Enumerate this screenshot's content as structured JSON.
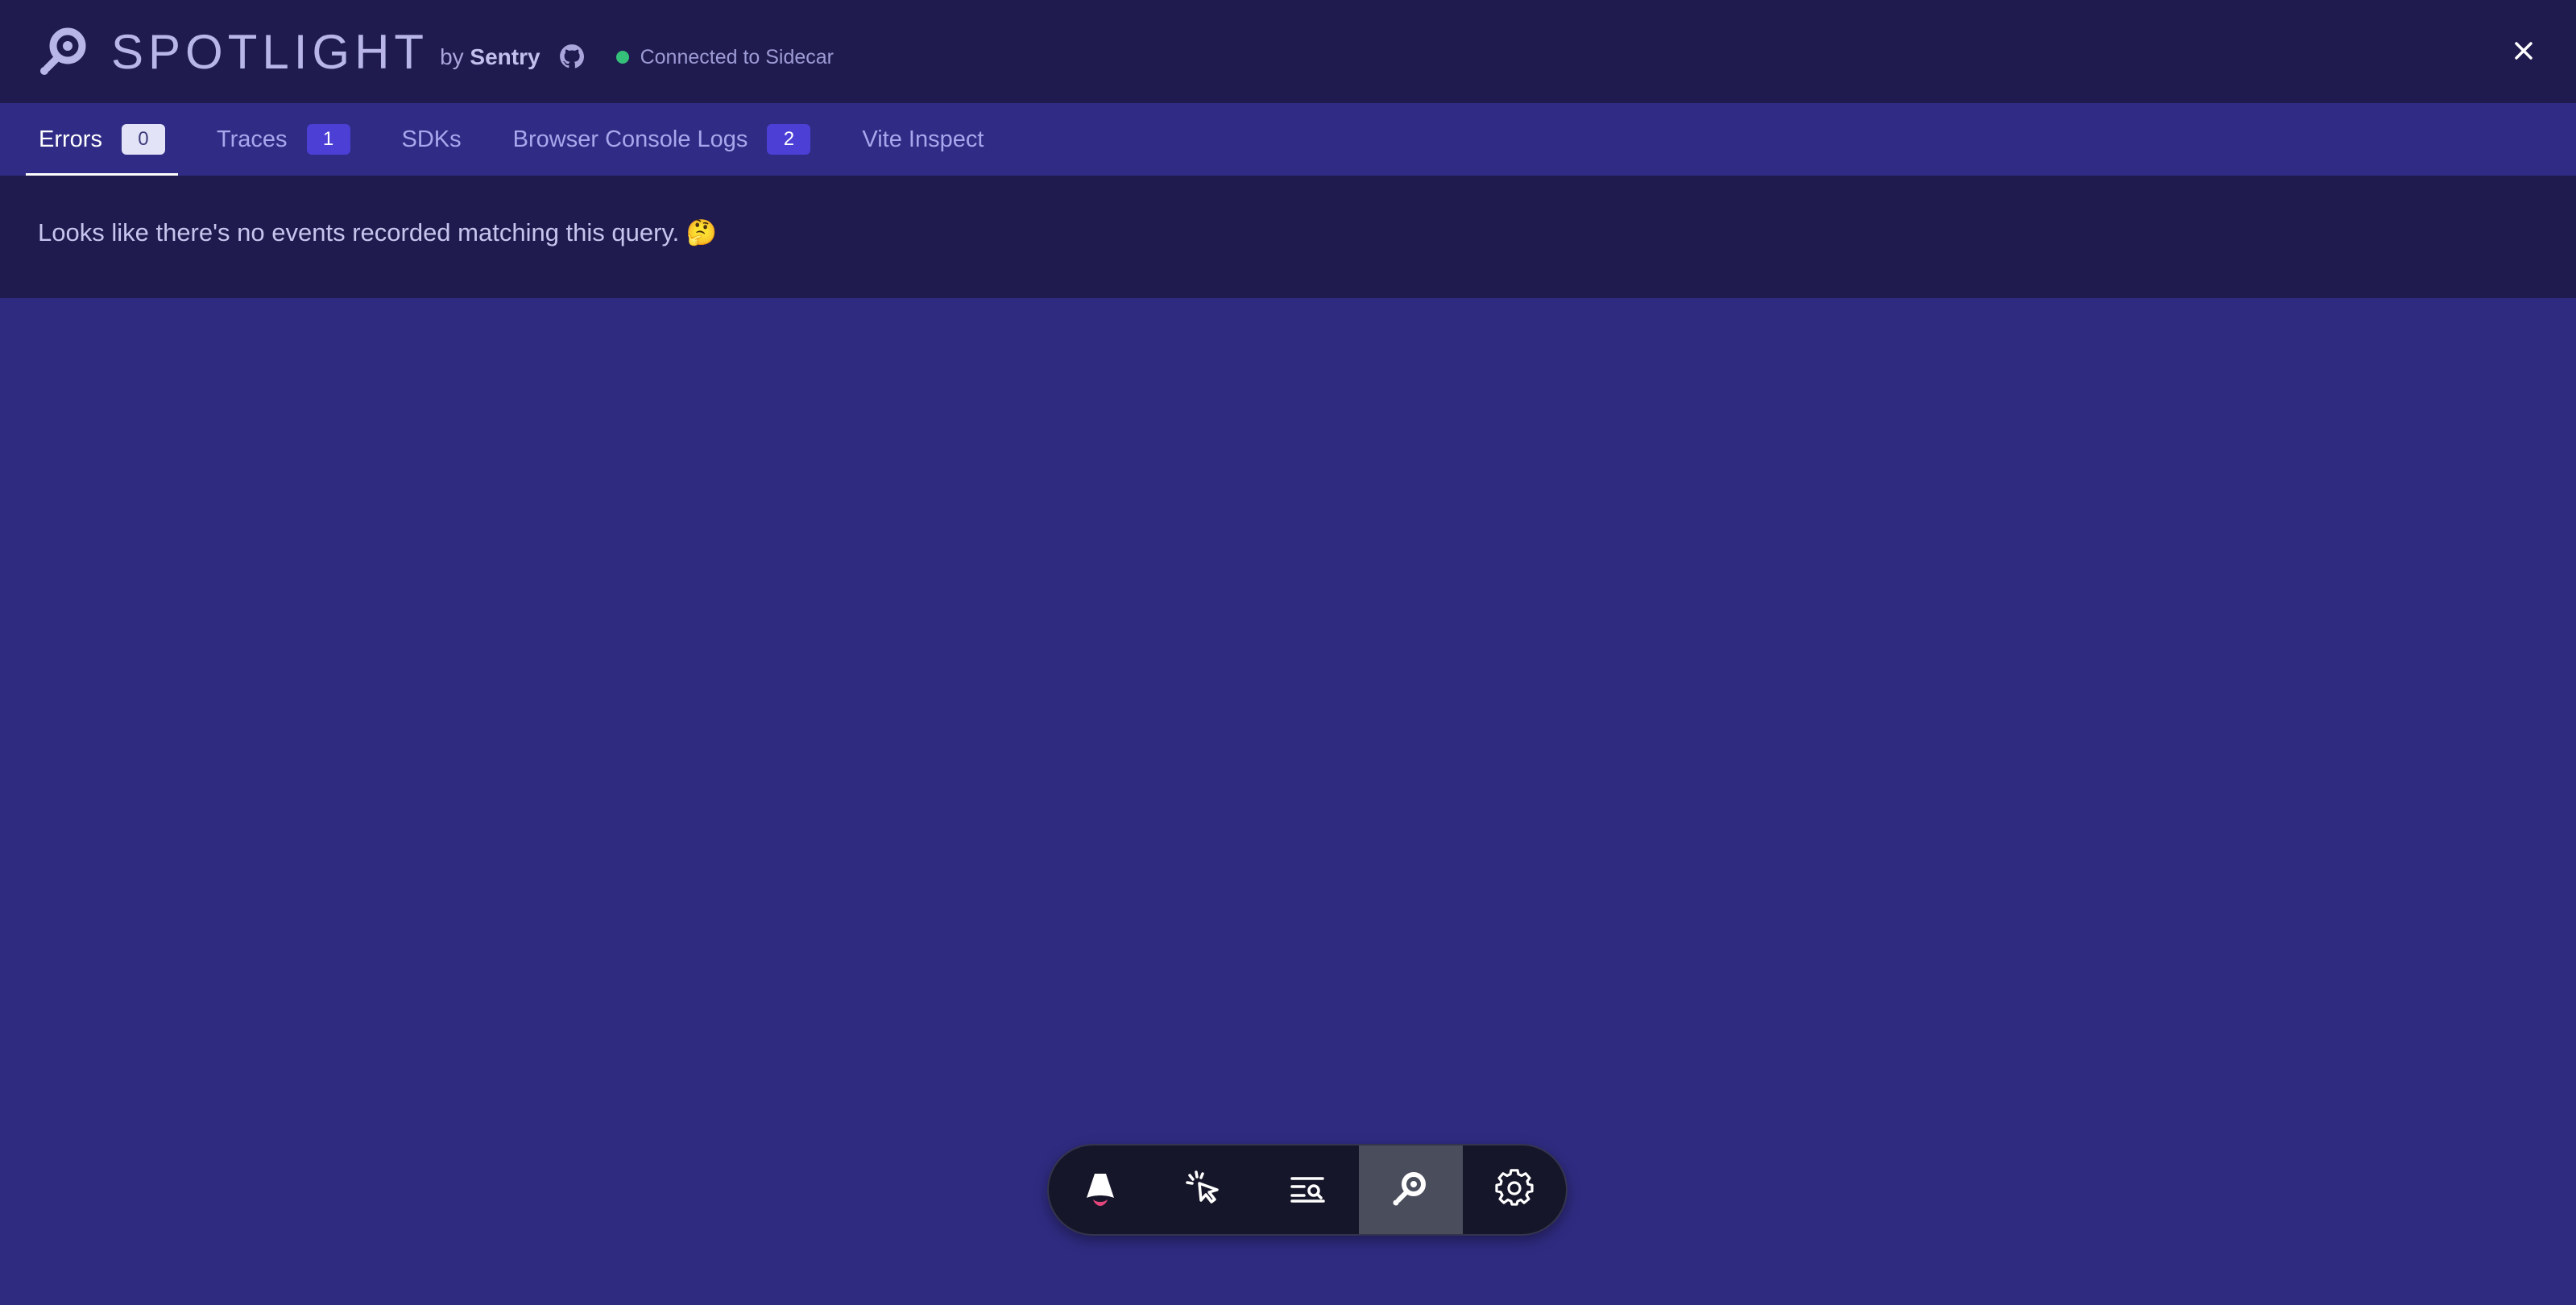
{
  "header": {
    "brand": "SPOTLIGHT",
    "by_prefix": "by",
    "by_name": "Sentry",
    "status_text": "Connected to Sidecar",
    "status_color": "#35c07a"
  },
  "tabs": [
    {
      "label": "Errors",
      "badge": "0",
      "active": true
    },
    {
      "label": "Traces",
      "badge": "1",
      "active": false
    },
    {
      "label": "SDKs",
      "badge": null,
      "active": false
    },
    {
      "label": "Browser Console Logs",
      "badge": "2",
      "active": false
    },
    {
      "label": "Vite Inspect",
      "badge": null,
      "active": false
    }
  ],
  "main": {
    "empty_message": "Looks like there's no events recorded matching this query. 🤔"
  },
  "toolbar": {
    "items": [
      {
        "icon": "astro-icon",
        "active": false
      },
      {
        "icon": "cursor-click-icon",
        "active": false
      },
      {
        "icon": "search-list-icon",
        "active": false
      },
      {
        "icon": "spotlight-icon",
        "active": true
      },
      {
        "icon": "gear-icon",
        "active": false
      }
    ]
  },
  "colors": {
    "header_bg": "#1f1b4e",
    "tabs_bg": "#302c85",
    "page_bg": "#2f2b80",
    "badge_bg": "#4b3fd6"
  }
}
